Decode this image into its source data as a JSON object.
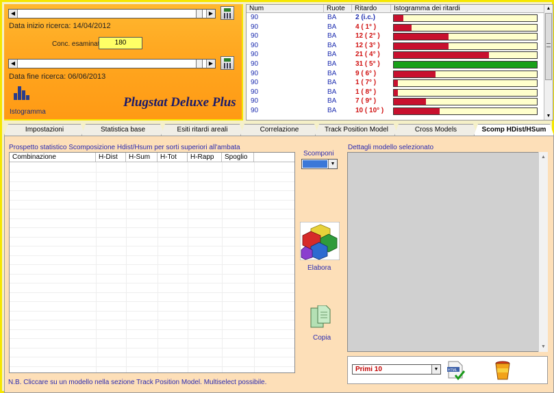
{
  "search": {
    "start_label": "Data inizio ricerca: 14/04/2012",
    "end_label": "Data fine ricerca: 06/06/2013",
    "conc_label": "Conc. esaminati",
    "conc_value": "180"
  },
  "app": {
    "title": "Plugstat Deluxe Plus",
    "istogramma_label": "Istogramma"
  },
  "grid": {
    "headers": [
      "Num",
      "Ruote",
      "Ritardo",
      "Istogramma dei ritardi"
    ],
    "rows": [
      {
        "num": "90",
        "ruote": "BA",
        "ritardo": "2  (i.c.)",
        "level": 0.065,
        "color": "#c8102e"
      },
      {
        "num": "90",
        "ruote": "BA",
        "ritardo": "4  ( 1° )",
        "level": 0.125,
        "color": "#c8102e"
      },
      {
        "num": "90",
        "ruote": "BA",
        "ritardo": "12  ( 2° )",
        "level": 0.385,
        "color": "#c8102e"
      },
      {
        "num": "90",
        "ruote": "BA",
        "ritardo": "12  ( 3° )",
        "level": 0.385,
        "color": "#c8102e"
      },
      {
        "num": "90",
        "ruote": "BA",
        "ritardo": "21  ( 4° )",
        "level": 0.665,
        "color": "#c8102e"
      },
      {
        "num": "90",
        "ruote": "BA",
        "ritardo": "31  ( 5° )",
        "level": 1.0,
        "color": "#19a019"
      },
      {
        "num": "90",
        "ruote": "BA",
        "ritardo": "9  ( 6° )",
        "level": 0.29,
        "color": "#c8102e"
      },
      {
        "num": "90",
        "ruote": "BA",
        "ritardo": "1  ( 7° )",
        "level": 0.03,
        "color": "#c8102e"
      },
      {
        "num": "90",
        "ruote": "BA",
        "ritardo": "1  ( 8° )",
        "level": 0.03,
        "color": "#c8102e"
      },
      {
        "num": "90",
        "ruote": "BA",
        "ritardo": "7  ( 9° )",
        "level": 0.225,
        "color": "#c8102e"
      },
      {
        "num": "90",
        "ruote": "BA",
        "ritardo": "10  ( 10° )",
        "level": 0.32,
        "color": "#c8102e"
      }
    ]
  },
  "tabs": [
    {
      "label": "Impostazioni",
      "active": false
    },
    {
      "label": "Statistica base",
      "active": false
    },
    {
      "label": "Esiti ritardi areali",
      "active": false
    },
    {
      "label": "Correlazione",
      "active": false
    },
    {
      "label": "Track Position Model",
      "active": false
    },
    {
      "label": "Cross Models",
      "active": false
    },
    {
      "label": "Scomp HDist/HSum",
      "active": true
    }
  ],
  "main": {
    "section_title": "Prospetto statistico Scomposizione Hdist/Hsum per sorti superiori all'ambata",
    "columns": [
      "Combinazione",
      "H-Dist",
      "H-Sum",
      "H-Tot",
      "H-Rapp",
      "Spoglio"
    ],
    "scomponi_label": "Scomponi",
    "elabora_label": "Elabora",
    "copia_label": "Copia",
    "detail_title": "Dettagli modello selezionato",
    "combo_value": "Primi 10",
    "note": "N.B. Cliccare su un modello nella sezione Track Position Model. Multiselect possibile."
  }
}
